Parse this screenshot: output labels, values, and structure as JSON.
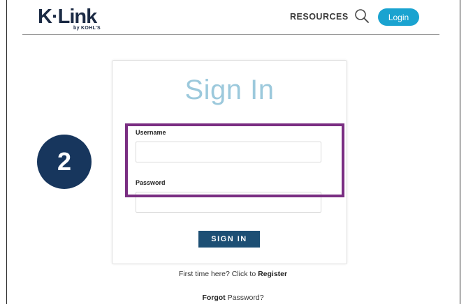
{
  "header": {
    "logo_text": "K·Link",
    "logo_sub": "by KOHL'S",
    "nav_resources": "RESOURCES",
    "search_icon": "search-icon",
    "login_label": "Login",
    "login_color": "#1aa3d0"
  },
  "card": {
    "title": "Sign In",
    "username_label": "Username",
    "username_value": "",
    "password_label": "Password",
    "password_value": "",
    "signin_label": "SIGN IN"
  },
  "footer": {
    "register_prefix": "First time here? Click to ",
    "register_link": "Register",
    "forgot_link": "Forgot",
    "forgot_suffix": " Password?"
  },
  "annotation": {
    "step_number": "2",
    "highlight_color": "#7a2e82",
    "badge_color": "#17365d"
  }
}
